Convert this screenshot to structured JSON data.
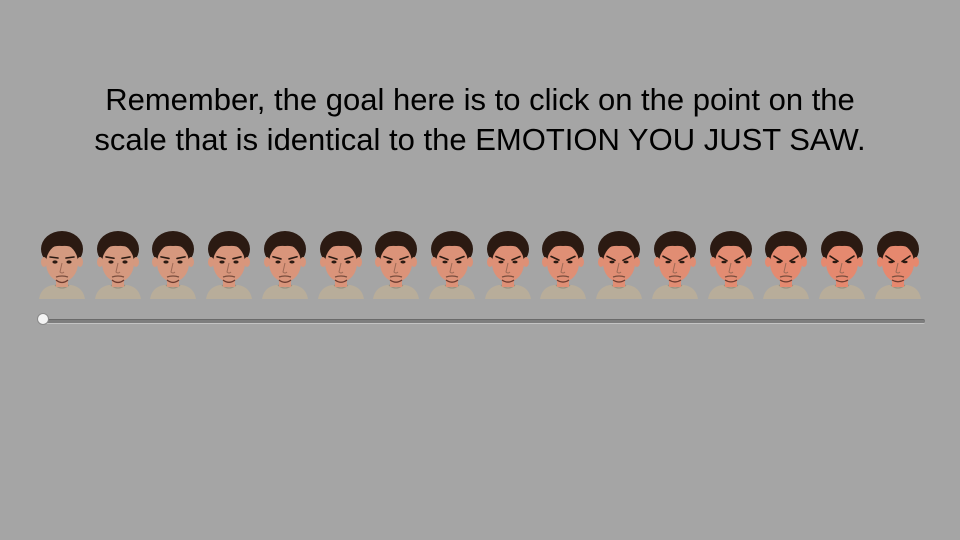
{
  "instruction": {
    "line1": "Remember, the goal here is to click on the point on the",
    "line2": "scale that is identical to the EMOTION YOU JUST SAW."
  },
  "scale": {
    "face_count": 16,
    "slider_value": 0,
    "slider_min": 0,
    "slider_max": 100
  },
  "colors": {
    "background": "#a5a5a5",
    "text": "#000000",
    "hair": "#2b1a12",
    "skin": "#d49a80",
    "shirt": "#b8ad9a"
  }
}
